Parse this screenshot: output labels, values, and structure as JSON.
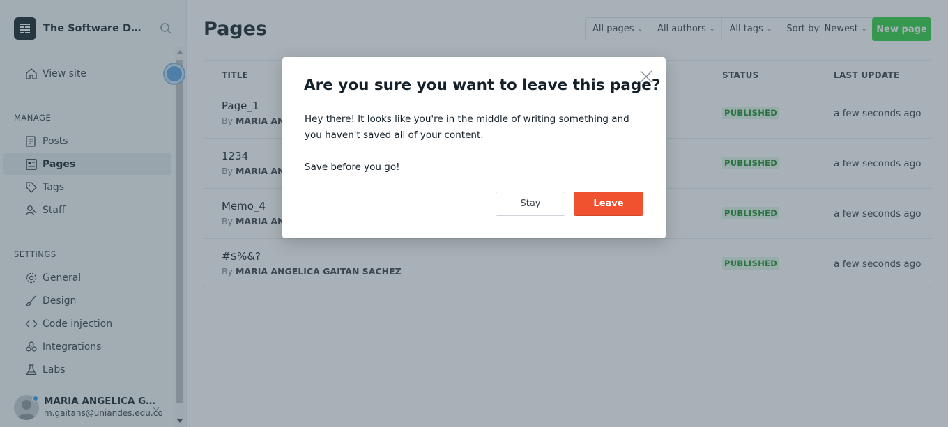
{
  "site": {
    "title": "The Software Design Lab"
  },
  "nav": {
    "view_site": "View site",
    "manage_title": "MANAGE",
    "manage": [
      {
        "label": "Posts",
        "icon": "posts-icon",
        "active": false
      },
      {
        "label": "Pages",
        "icon": "pages-icon",
        "active": true
      },
      {
        "label": "Tags",
        "icon": "tag-icon",
        "active": false
      },
      {
        "label": "Staff",
        "icon": "staff-icon",
        "active": false
      }
    ],
    "settings_title": "SETTINGS",
    "settings": [
      {
        "label": "General",
        "icon": "gear-icon"
      },
      {
        "label": "Design",
        "icon": "brush-icon"
      },
      {
        "label": "Code injection",
        "icon": "code-icon"
      },
      {
        "label": "Integrations",
        "icon": "integrations-icon"
      },
      {
        "label": "Labs",
        "icon": "flask-icon"
      }
    ]
  },
  "user": {
    "name": "MARIA ANGELICA GAITAN SACHEZ",
    "email": "m.gaitans@uniandes.edu.co"
  },
  "header": {
    "title": "Pages",
    "filters": {
      "pages": "All pages",
      "authors": "All authors",
      "tags": "All tags",
      "sort": "Sort by: Newest"
    },
    "new_button": "New page"
  },
  "table": {
    "col_title": "TITLE",
    "col_status": "STATUS",
    "col_updated": "LAST UPDATE",
    "rows": [
      {
        "title": "Page_1",
        "by": "By",
        "author": "MARIA ANGELICA GAITAN SACHEZ",
        "status": "PUBLISHED",
        "updated": "a few seconds ago"
      },
      {
        "title": "1234",
        "by": "By",
        "author": "MARIA ANGELICA GAITAN SACHEZ",
        "status": "PUBLISHED",
        "updated": "a few seconds ago"
      },
      {
        "title": "Memo_4",
        "by": "By",
        "author": "MARIA ANGELICA GAITAN SACHEZ",
        "status": "PUBLISHED",
        "updated": "a few seconds ago"
      },
      {
        "title": "#$%&?",
        "by": "By",
        "author": "MARIA ANGELICA GAITAN SACHEZ",
        "status": "PUBLISHED",
        "updated": "a few seconds ago"
      }
    ]
  },
  "modal": {
    "title": "Are you sure you want to leave this page?",
    "paragraph1": "Hey there! It looks like you're in the middle of writing something and you haven't saved all of your content.",
    "paragraph2": "Save before you go!",
    "stay": "Stay",
    "leave": "Leave"
  },
  "colors": {
    "accent_green": "#30cf43",
    "danger": "#f05230",
    "overlay": "rgba(63, 82, 95, 0.45)"
  }
}
